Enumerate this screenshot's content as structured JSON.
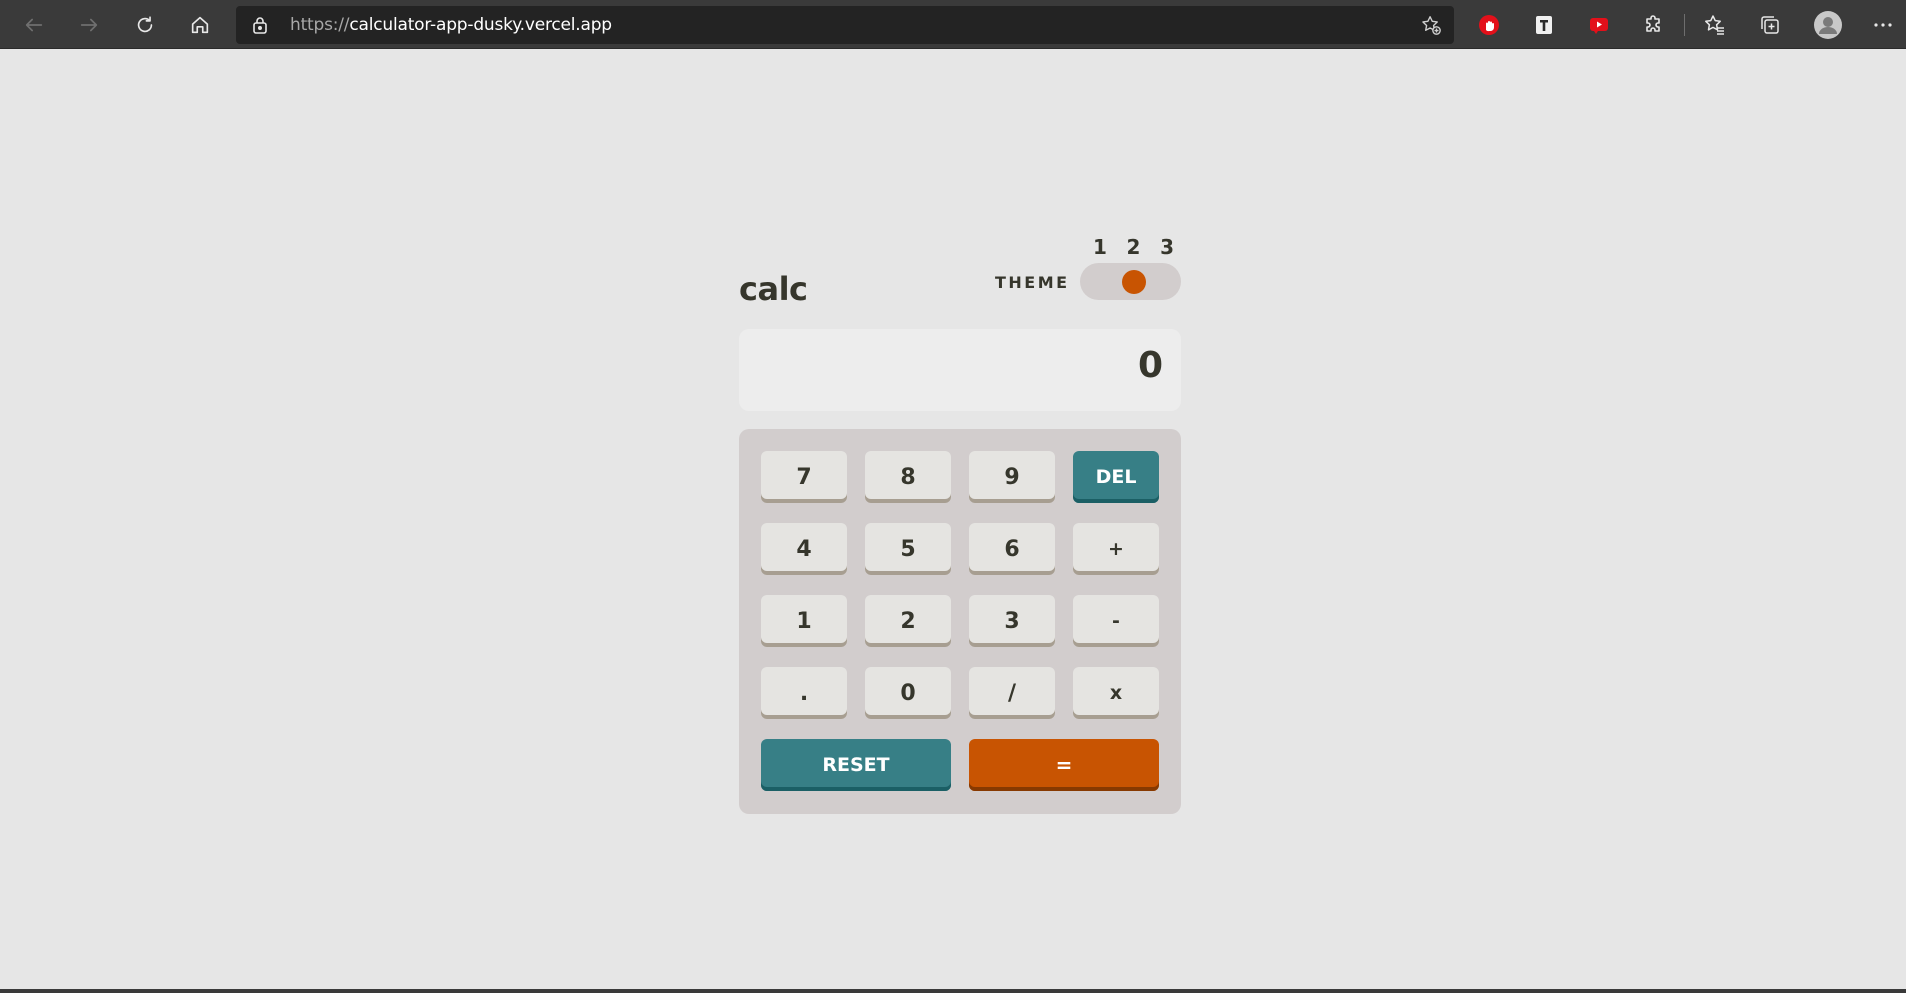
{
  "browser": {
    "url_protocol": "https://",
    "url_host": "calculator-app-dusky.vercel.app",
    "icons": [
      "back-icon",
      "forward-icon",
      "refresh-icon",
      "home-icon",
      "lock-icon",
      "add-favorite-icon",
      "adblock-icon",
      "extension-t-icon",
      "youtube-extension-icon",
      "extensions-puzzle-icon",
      "favorites-icon",
      "collections-icon",
      "profile-avatar-icon",
      "more-menu-icon"
    ]
  },
  "calculator": {
    "logo": "calc",
    "theme_label": "THEME",
    "theme_numbers": [
      "1",
      "2",
      "3"
    ],
    "selected_theme": 2,
    "display": "0",
    "keys": [
      {
        "label": "7",
        "name": "key-7"
      },
      {
        "label": "8",
        "name": "key-8"
      },
      {
        "label": "9",
        "name": "key-9"
      },
      {
        "label": "DEL",
        "name": "delete-button"
      },
      {
        "label": "4",
        "name": "key-4"
      },
      {
        "label": "5",
        "name": "key-5"
      },
      {
        "label": "6",
        "name": "key-6"
      },
      {
        "label": "+",
        "name": "add-button"
      },
      {
        "label": "1",
        "name": "key-1"
      },
      {
        "label": "2",
        "name": "key-2"
      },
      {
        "label": "3",
        "name": "key-3"
      },
      {
        "label": "-",
        "name": "subtract-button"
      },
      {
        "label": ".",
        "name": "decimal-button"
      },
      {
        "label": "0",
        "name": "key-0"
      },
      {
        "label": "/",
        "name": "divide-button"
      },
      {
        "label": "x",
        "name": "multiply-button"
      },
      {
        "label": "RESET",
        "name": "reset-button"
      },
      {
        "label": "=",
        "name": "equals-button"
      }
    ]
  },
  "colors": {
    "page_background": "#e6e6e6",
    "keypad_background": "#d2cdcd",
    "screen_background": "#ededed",
    "key_background": "#e5e4e1",
    "accent_teal": "#377f86",
    "accent_orange": "#c85402",
    "text_dark": "#36362c"
  }
}
